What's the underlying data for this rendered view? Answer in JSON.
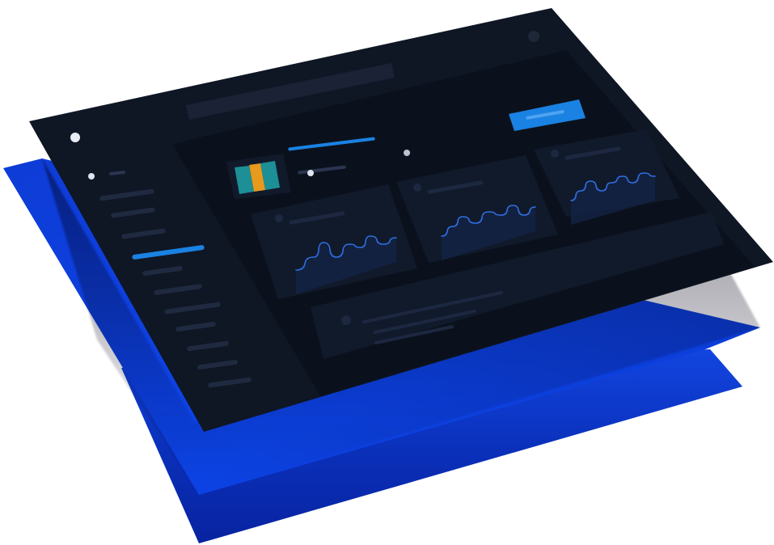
{
  "colors": {
    "background": "#ffffff",
    "layer_back": "#0d36c9",
    "layer_middle": "#0e45e6",
    "panel_frame": "#0f1522",
    "panel_main": "#0a0f19",
    "card": "#111a2c",
    "placeholder": "#1c2740",
    "accent": "#1a82e2",
    "line_chart": "#2f6ee0",
    "logo_teal": "#1d8f96",
    "logo_orange": "#e89a1c"
  },
  "sidebar": {
    "items": [
      {
        "state": "default"
      },
      {
        "state": "default"
      },
      {
        "state": "default"
      },
      {
        "state": "active"
      },
      {
        "state": "default"
      },
      {
        "state": "default"
      },
      {
        "state": "default"
      },
      {
        "state": "default"
      },
      {
        "state": "default"
      },
      {
        "state": "default"
      },
      {
        "state": "default"
      }
    ]
  },
  "header": {
    "search_icon": "search-bar",
    "action_button": "primary-button"
  },
  "profile": {
    "logo": "striped-logo",
    "name_bar": "accent-line"
  },
  "widgets": [
    {
      "type": "line-chart-card"
    },
    {
      "type": "line-chart-card"
    },
    {
      "type": "line-chart-card"
    }
  ],
  "icons": {
    "window_dot": "circle-icon",
    "avatar": "circle-icon"
  }
}
